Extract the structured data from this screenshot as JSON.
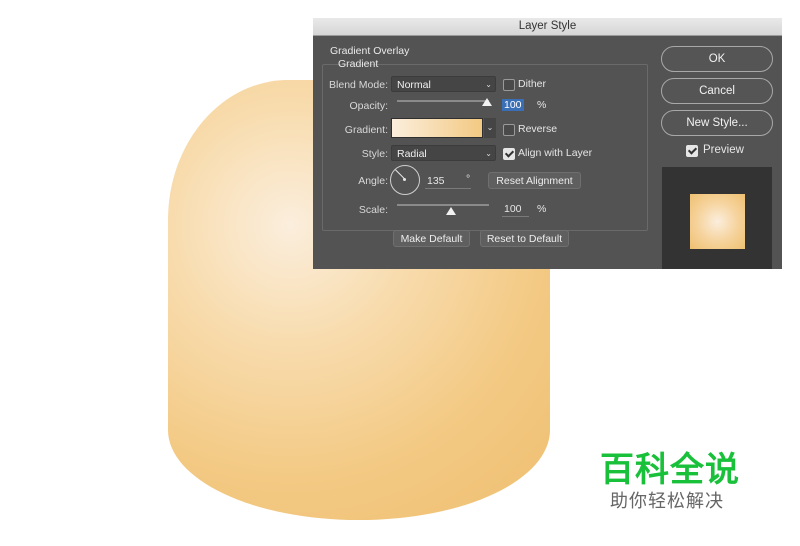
{
  "window": {
    "title": "Layer Style"
  },
  "section": {
    "title": "Gradient Overlay",
    "group": "Gradient"
  },
  "fields": {
    "blend_mode": {
      "label": "Blend Mode:",
      "value": "Normal"
    },
    "dither": {
      "label": "Dither",
      "checked": false
    },
    "opacity": {
      "label": "Opacity:",
      "value": "100",
      "unit": "%",
      "level": 1.0
    },
    "gradient": {
      "label": "Gradient:",
      "colors": [
        "#fbeedd",
        "#f3c983"
      ]
    },
    "reverse": {
      "label": "Reverse",
      "checked": false
    },
    "style": {
      "label": "Style:",
      "value": "Radial"
    },
    "align_with_layer": {
      "label": "Align with Layer",
      "checked": true
    },
    "angle": {
      "label": "Angle:",
      "value": "135",
      "unit": "°"
    },
    "scale": {
      "label": "Scale:",
      "value": "100",
      "unit": "%",
      "level": 0.5
    }
  },
  "buttons": {
    "reset_alignment": "Reset Alignment",
    "make_default": "Make Default",
    "reset_to_default": "Reset to Default",
    "ok": "OK",
    "cancel": "Cancel",
    "new_style": "New Style..."
  },
  "preview": {
    "label": "Preview",
    "checked": true
  },
  "watermark": {
    "main": "百科全说",
    "sub": "助你轻松解决"
  },
  "colors": {
    "shape_light": "#fbeedd",
    "shape_dark": "#eebf70",
    "dialog_bg": "#535353",
    "watermark_green": "#19c03a"
  }
}
